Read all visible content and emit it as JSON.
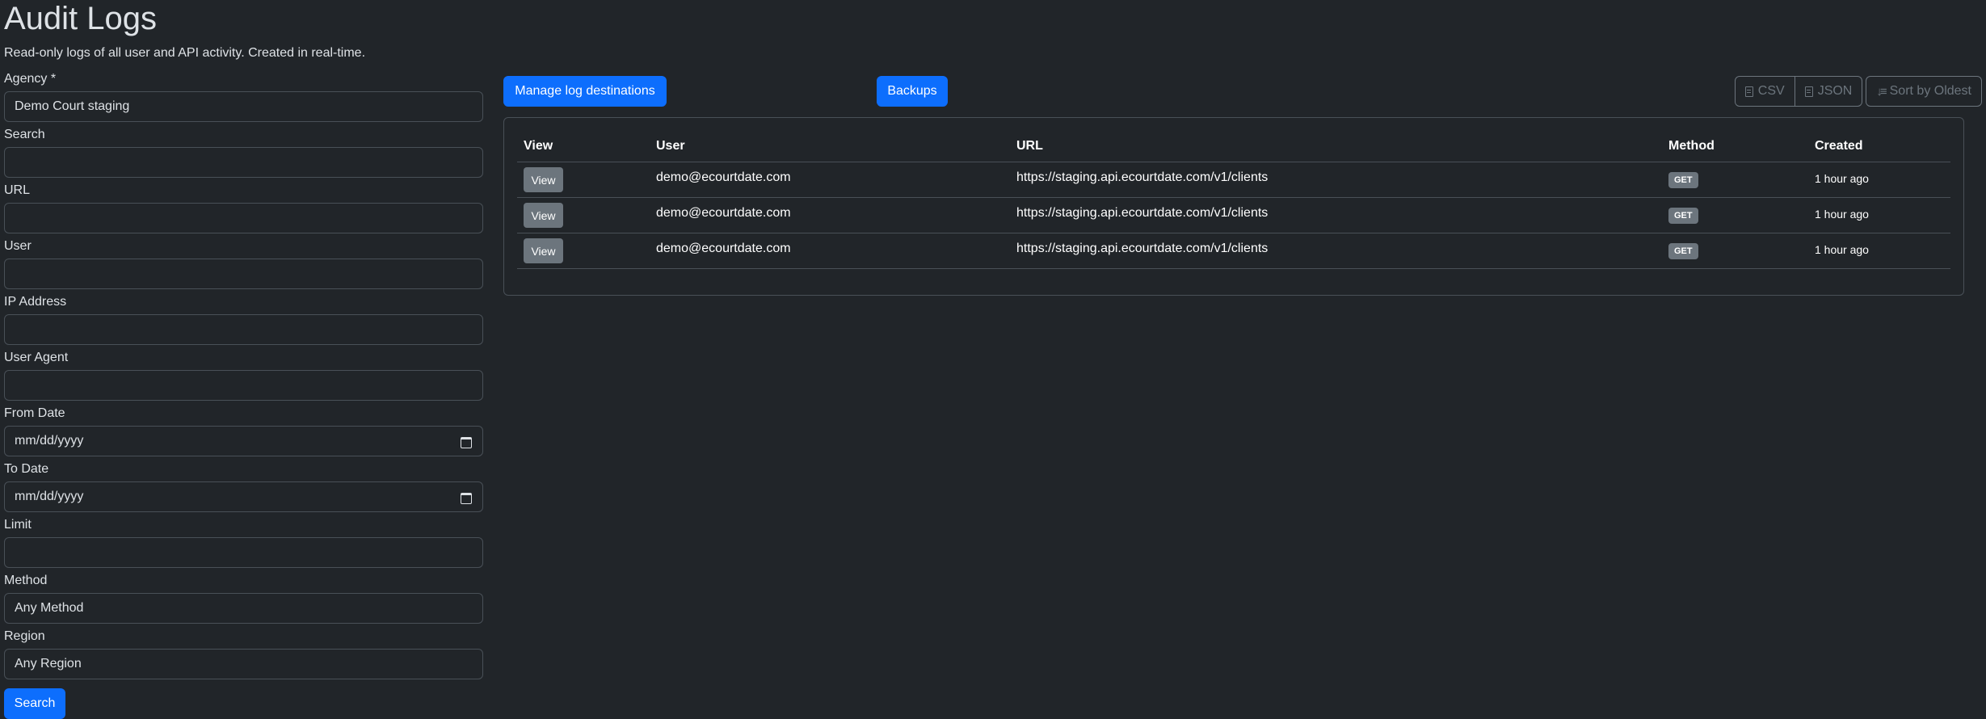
{
  "header": {
    "title": "Audit Logs",
    "subtitle": "Read-only logs of all user and API activity. Created in real-time."
  },
  "filters": {
    "agency": {
      "label": "Agency *",
      "value": "Demo Court staging"
    },
    "search": {
      "label": "Search",
      "value": ""
    },
    "url": {
      "label": "URL",
      "value": ""
    },
    "user": {
      "label": "User",
      "value": ""
    },
    "ip_address": {
      "label": "IP Address",
      "value": ""
    },
    "user_agent": {
      "label": "User Agent",
      "value": ""
    },
    "from_date": {
      "label": "From Date",
      "placeholder": "mm/dd/yyyy"
    },
    "to_date": {
      "label": "To Date",
      "placeholder": "mm/dd/yyyy"
    },
    "limit": {
      "label": "Limit",
      "value": ""
    },
    "method": {
      "label": "Method",
      "value": "Any Method"
    },
    "region": {
      "label": "Region",
      "value": "Any Region"
    },
    "search_button": "Search"
  },
  "toolbar": {
    "manage_label": "Manage log destinations",
    "backups_label": "Backups",
    "csv_label": "CSV",
    "json_label": "JSON",
    "sort_label": "Sort by Oldest"
  },
  "table": {
    "headers": {
      "view": "View",
      "user": "User",
      "url": "URL",
      "method": "Method",
      "created": "Created"
    },
    "rows": [
      {
        "view": "View",
        "user": "demo@ecourtdate.com",
        "url": "https://staging.api.ecourtdate.com/v1/clients",
        "method": "GET",
        "created": "1 hour ago"
      },
      {
        "view": "View",
        "user": "demo@ecourtdate.com",
        "url": "https://staging.api.ecourtdate.com/v1/clients",
        "method": "GET",
        "created": "1 hour ago"
      },
      {
        "view": "View",
        "user": "demo@ecourtdate.com",
        "url": "https://staging.api.ecourtdate.com/v1/clients",
        "method": "GET",
        "created": "1 hour ago"
      }
    ]
  },
  "colors": {
    "background": "#212529",
    "primary": "#0d6efd",
    "secondary": "#6c757d",
    "border": "#495057"
  },
  "icons": {
    "calendar": "calendar-icon",
    "csv": "file-csv-icon",
    "json": "file-json-icon",
    "sort": "sort-icon"
  }
}
